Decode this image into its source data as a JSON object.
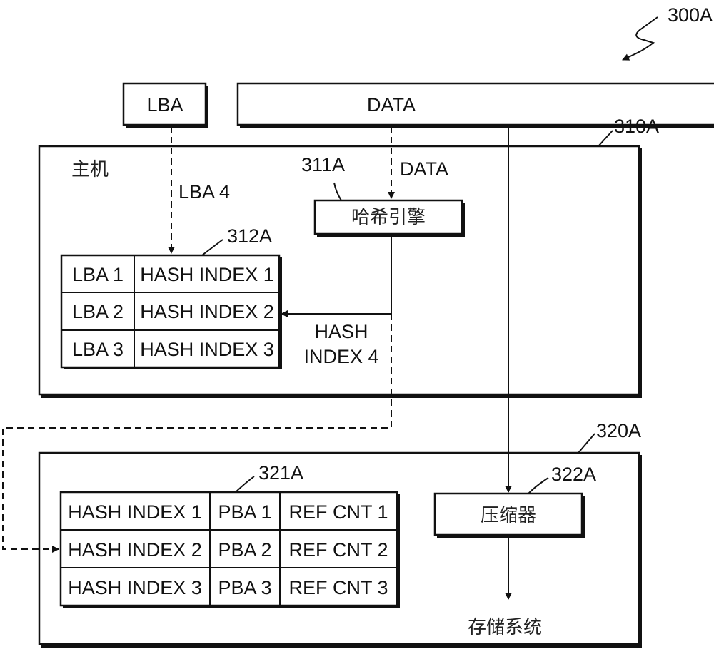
{
  "figure_ref": "300A",
  "inputs": {
    "lba_label": "LBA",
    "data_label": "DATA"
  },
  "host": {
    "ref": "310A",
    "title": "主机",
    "lba_arrow_label": "LBA 4",
    "data_arrow_label": "DATA",
    "hash_engine": {
      "ref": "311A",
      "label": "哈希引擎"
    },
    "hash_index_arrow_label": [
      "HASH",
      "INDEX 4"
    ],
    "mapping_table": {
      "ref": "312A",
      "rows": [
        [
          "LBA 1",
          "HASH INDEX 1"
        ],
        [
          "LBA 2",
          "HASH INDEX 2"
        ],
        [
          "LBA 3",
          "HASH INDEX 3"
        ]
      ]
    }
  },
  "storage": {
    "ref": "320A",
    "hash_table": {
      "ref": "321A",
      "rows": [
        [
          "HASH INDEX 1",
          "PBA 1",
          "REF CNT 1"
        ],
        [
          "HASH INDEX 2",
          "PBA 2",
          "REF CNT 2"
        ],
        [
          "HASH INDEX 3",
          "PBA 3",
          "REF CNT 3"
        ]
      ]
    },
    "compressor": {
      "ref": "322A",
      "label": "压缩器"
    },
    "output_label": "存储系统"
  }
}
